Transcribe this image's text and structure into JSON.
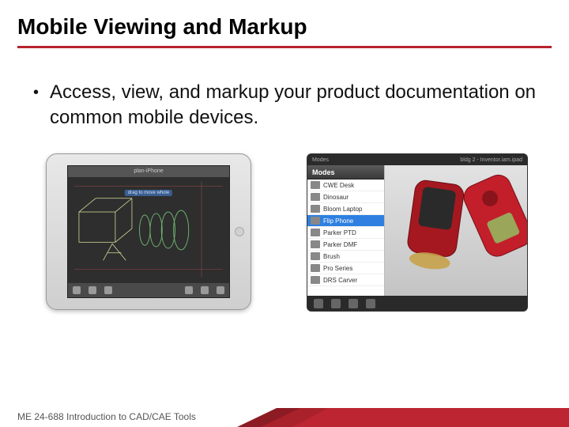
{
  "title": "Mobile Viewing and Markup",
  "bullet": "Access, view, and markup your product documentation on common mobile devices.",
  "ipad": {
    "topbar_text": "plan-iPhone",
    "hint_label": "drag to move whole"
  },
  "tablet": {
    "top_left": "Modes",
    "top_right": "bldg 2 - Inventor.iam.ipad",
    "sidebar_header": "Modes",
    "items": [
      "CWE Desk",
      "Dinosaur",
      "Bloom Laptop",
      "Flip Phone",
      "Parker PTD",
      "Parker DMF",
      "Brush",
      "Pro Series",
      "DRS Carver"
    ],
    "selected_index": 3
  },
  "footer": "ME 24-688 Introduction to CAD/CAE Tools"
}
